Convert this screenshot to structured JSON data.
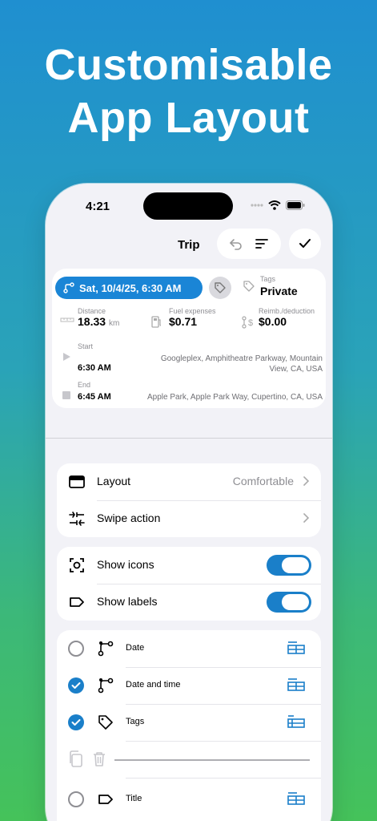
{
  "headline": {
    "line1": "Customisable",
    "line2": "App Layout"
  },
  "status_bar": {
    "time": "4:21",
    "icons": [
      "signal-dots-icon",
      "wifi-icon",
      "battery-icon"
    ]
  },
  "nav": {
    "title": "Trip",
    "actions": [
      "undo-icon",
      "sort-icon",
      "check-icon"
    ]
  },
  "trip": {
    "date_chip": "Sat, 10/4/25, 6:30 AM",
    "tags_label": "Tags",
    "tags_value": "Private",
    "distance_label": "Distance",
    "distance_value": "18.33",
    "distance_unit": "km",
    "fuel_label": "Fuel expenses",
    "fuel_value": "$0.71",
    "reimb_label": "Reimb./deduction",
    "reimb_value": "$0.00",
    "start_label": "Start",
    "start_time": "6:30 AM",
    "start_addr_1": "Googleplex, Amphitheatre Parkway, Mountain",
    "start_addr_2": "View, CA, USA",
    "end_label": "End",
    "end_time": "6:45 AM",
    "end_addr": "Apple Park, Apple Park Way, Cupertino, CA, USA"
  },
  "settings": {
    "layout_label": "Layout",
    "layout_value": "Comfortable",
    "swipe_label": "Swipe action",
    "show_icons_label": "Show icons",
    "show_icons_on": true,
    "show_labels_label": "Show labels",
    "show_labels_on": true
  },
  "fields": [
    {
      "label": "Date",
      "checked": false
    },
    {
      "label": "Date and time",
      "checked": true
    },
    {
      "label": "Tags",
      "checked": true
    },
    {
      "label": "Title",
      "checked": false
    }
  ],
  "colors": {
    "accent": "#1a7fc9",
    "chip": "#1a85d6",
    "gradient_top": "#1f8fd0",
    "gradient_bottom": "#45c25a"
  }
}
